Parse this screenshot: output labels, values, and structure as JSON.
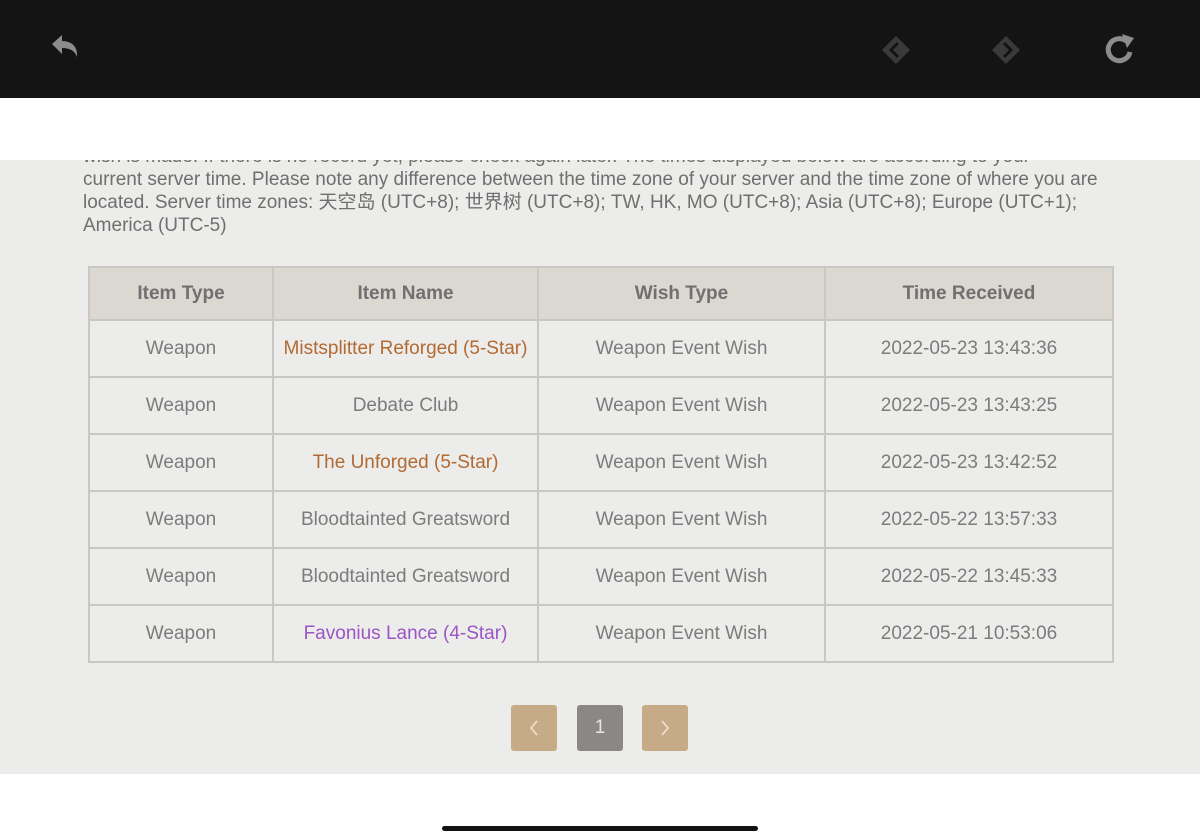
{
  "notice": {
    "partial_line": "wish is made. If there is no record yet, please check again later. The times displayed below are according to your",
    "text": "current server time. Please note any difference between the time zone of your server and the time zone of where you are located. Server time zones: 天空岛 (UTC+8); 世界树 (UTC+8); TW, HK, MO (UTC+8); Asia (UTC+8); Europe (UTC+1); America (UTC-5)"
  },
  "table": {
    "headers": [
      "Item Type",
      "Item Name",
      "Wish Type",
      "Time Received"
    ],
    "rows": [
      {
        "type": "Weapon",
        "name": "Mistsplitter Reforged (5-Star)",
        "wish": "Weapon Event Wish",
        "time": "2022-05-23 13:43:36",
        "rarity": 5
      },
      {
        "type": "Weapon",
        "name": "Debate Club",
        "wish": "Weapon Event Wish",
        "time": "2022-05-23 13:43:25",
        "rarity": 3
      },
      {
        "type": "Weapon",
        "name": "The Unforged (5-Star)",
        "wish": "Weapon Event Wish",
        "time": "2022-05-23 13:42:52",
        "rarity": 5
      },
      {
        "type": "Weapon",
        "name": "Bloodtainted Greatsword",
        "wish": "Weapon Event Wish",
        "time": "2022-05-22 13:57:33",
        "rarity": 3
      },
      {
        "type": "Weapon",
        "name": "Bloodtainted Greatsword",
        "wish": "Weapon Event Wish",
        "time": "2022-05-22 13:45:33",
        "rarity": 3
      },
      {
        "type": "Weapon",
        "name": "Favonius Lance (4-Star)",
        "wish": "Weapon Event Wish",
        "time": "2022-05-21 10:53:06",
        "rarity": 4
      }
    ]
  },
  "pagination": {
    "prev_icon": "chevron-left-icon",
    "current_page": "1",
    "next_icon": "chevron-right-icon"
  },
  "toolbar": {
    "back_icon": "undo-arrow-icon",
    "prev_icon": "diamond-left-icon",
    "next_icon": "diamond-right-icon",
    "reload_icon": "reload-icon"
  },
  "colors": {
    "five_star": "#b26a34",
    "four_star": "#9b55c4",
    "three_star": "#7c7c7c",
    "pager_nav": "#c7ab86",
    "pager_current": "#8a8785"
  }
}
